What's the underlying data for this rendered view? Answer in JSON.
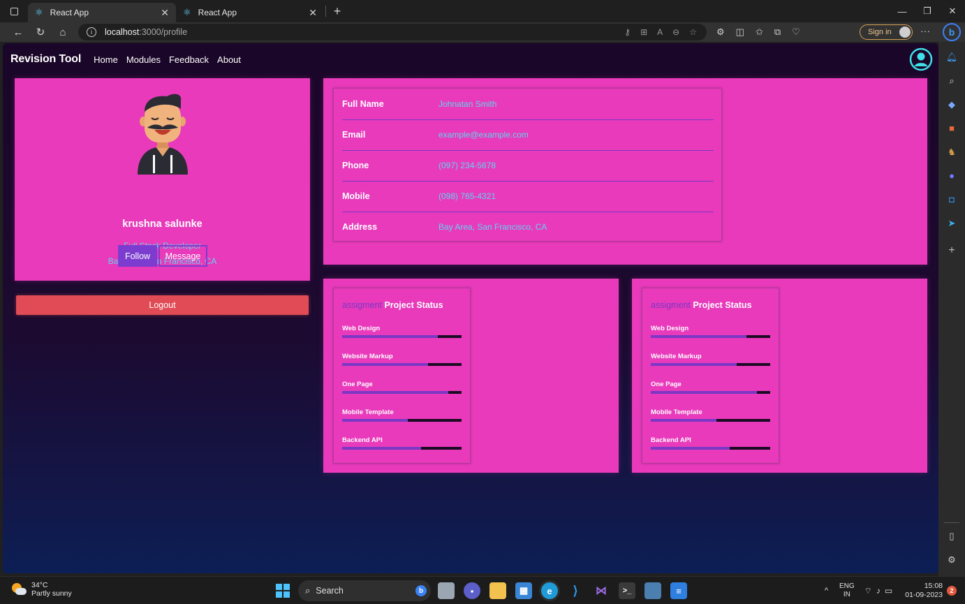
{
  "browser": {
    "tabs": [
      {
        "title": "React App",
        "active": true
      },
      {
        "title": "React App",
        "active": false
      }
    ],
    "url_host": "localhost",
    "url_path": ":3000/profile",
    "signin_label": "Sign in"
  },
  "app": {
    "brand": "Revision Tool",
    "nav": [
      "Home",
      "Modules",
      "Feedback",
      "About"
    ]
  },
  "profile": {
    "name": "krushna salunke",
    "role": "Full Stack Developer",
    "location": "Bay Area, San Francisco, CA",
    "follow_label": "Follow",
    "message_label": "Message",
    "logout_label": "Logout"
  },
  "details": [
    {
      "label": "Full Name",
      "value": "Johnatan Smith"
    },
    {
      "label": "Email",
      "value": "example@example.com"
    },
    {
      "label": "Phone",
      "value": "(097) 234-5678"
    },
    {
      "label": "Mobile",
      "value": "(098) 765-4321"
    },
    {
      "label": "Address",
      "value": "Bay Area, San Francisco, CA"
    }
  ],
  "status_cards": [
    {
      "prefix": "assigment",
      "title": "Project Status",
      "items": [
        {
          "label": "Web Design",
          "progress": 0.8
        },
        {
          "label": "Website Markup",
          "progress": 0.72
        },
        {
          "label": "One Page",
          "progress": 0.89
        },
        {
          "label": "Mobile Template",
          "progress": 0.55
        },
        {
          "label": "Backend API",
          "progress": 0.66
        }
      ]
    },
    {
      "prefix": "assigment",
      "title": "Project Status",
      "items": [
        {
          "label": "Web Design",
          "progress": 0.8
        },
        {
          "label": "Website Markup",
          "progress": 0.72
        },
        {
          "label": "One Page",
          "progress": 0.89
        },
        {
          "label": "Mobile Template",
          "progress": 0.55
        },
        {
          "label": "Backend API",
          "progress": 0.66
        }
      ]
    }
  ],
  "taskbar": {
    "temp": "34°C",
    "weather": "Partly sunny",
    "search": "Search",
    "lang_1": "ENG",
    "lang_2": "IN",
    "time": "15:08",
    "date": "01-09-2023",
    "notifications": "2"
  },
  "colors": {
    "card": "#e83abb",
    "accent": "#7a38c4",
    "cyan_text": "#5ed8ee",
    "logout": "#e04b55"
  }
}
